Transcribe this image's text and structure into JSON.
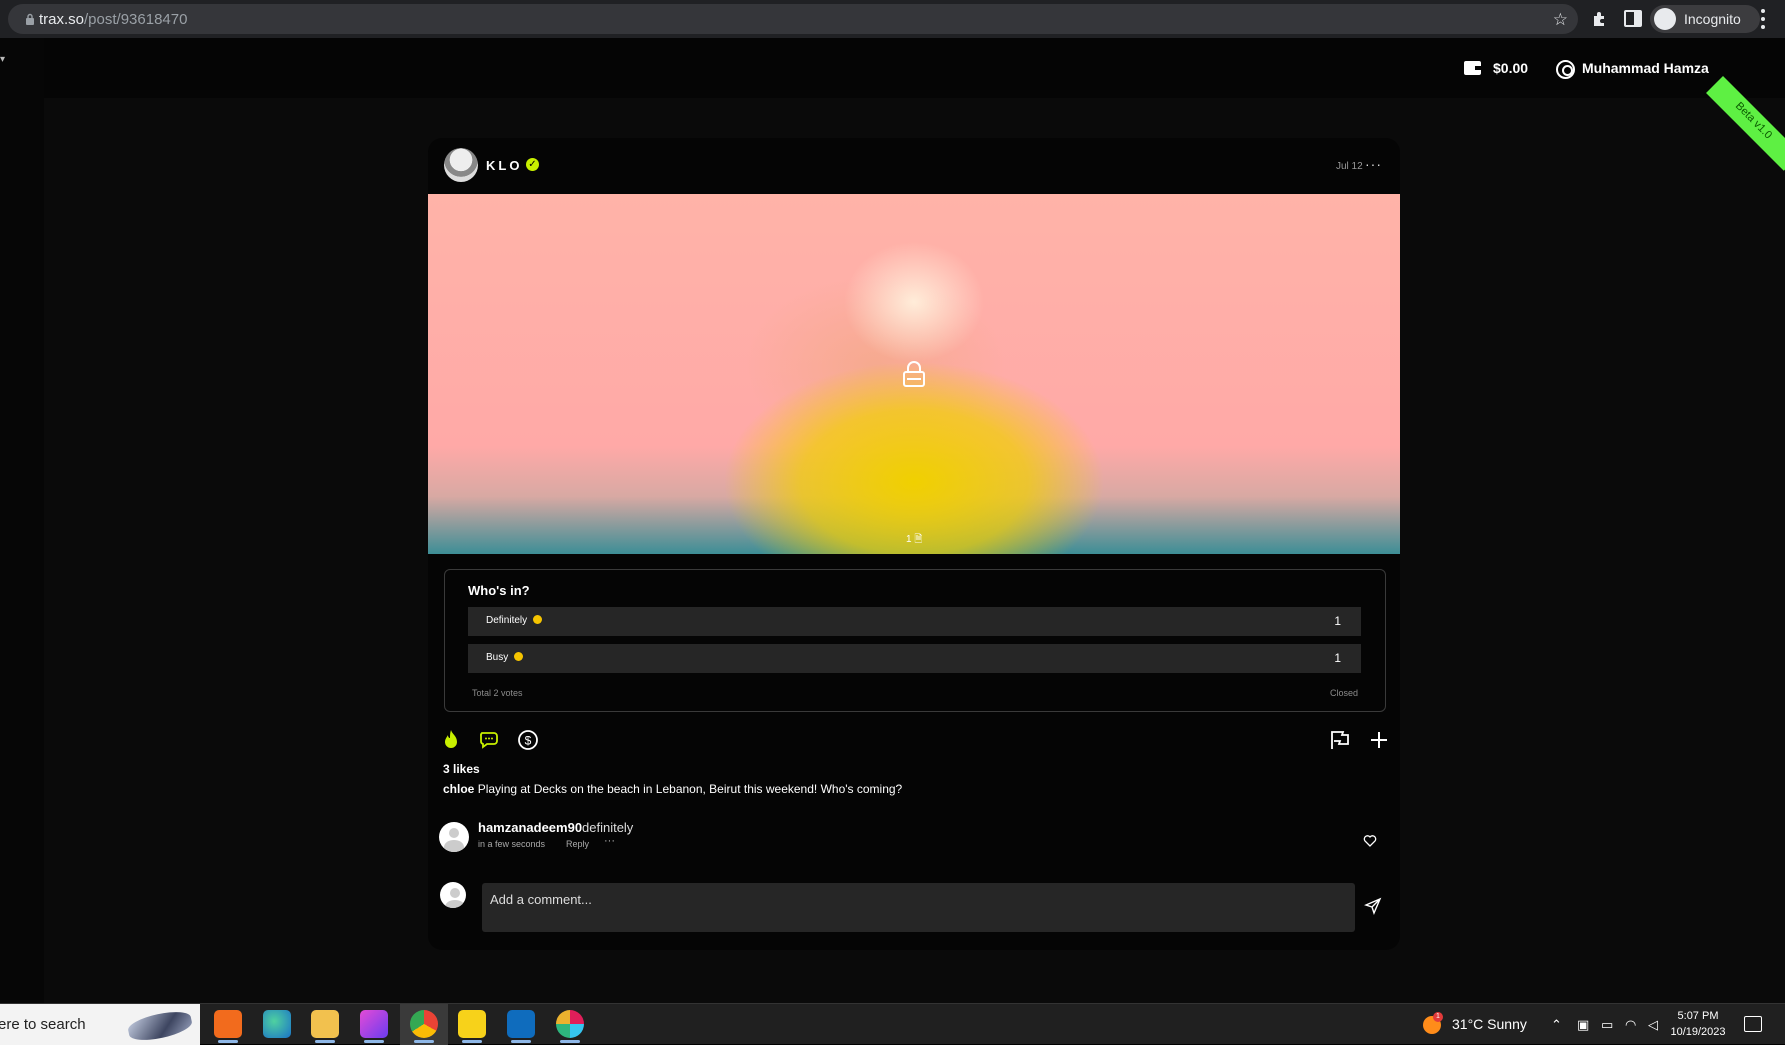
{
  "browser": {
    "url_domain": "trax.so",
    "url_path": "/post/93618470",
    "profile_label": "Incognito"
  },
  "header": {
    "balance": "$0.00",
    "username": "Muhammad Hamza",
    "beta_label": "Beta v1.0"
  },
  "post": {
    "author": "KLO",
    "date": "Jul 12",
    "menu_glyph": "···",
    "media_count": "1",
    "poll": {
      "title": "Who's in?",
      "options": [
        {
          "label": "Definitely",
          "count": "1"
        },
        {
          "label": "Busy",
          "count": "1"
        }
      ],
      "total": "Total 2 votes",
      "status": "Closed"
    },
    "likes": "3 likes",
    "caption_author": "chloe",
    "caption_text": "Playing at Decks on the beach in Lebanon, Beirut this weekend! Who's coming?",
    "comment": {
      "user": "hamzanadeem90",
      "text": "definitely",
      "time": "in a few seconds",
      "reply_label": "Reply",
      "more_glyph": "···"
    },
    "comment_placeholder": "Add a comment..."
  },
  "taskbar": {
    "search_text": "ere to search",
    "weather": "31°C  Sunny",
    "weather_badge": "1",
    "time": "5:07 PM",
    "date": "10/19/2023"
  },
  "colors": {
    "accent": "#c8f000",
    "beta": "#5ef043",
    "poll_bar": "#262626"
  }
}
